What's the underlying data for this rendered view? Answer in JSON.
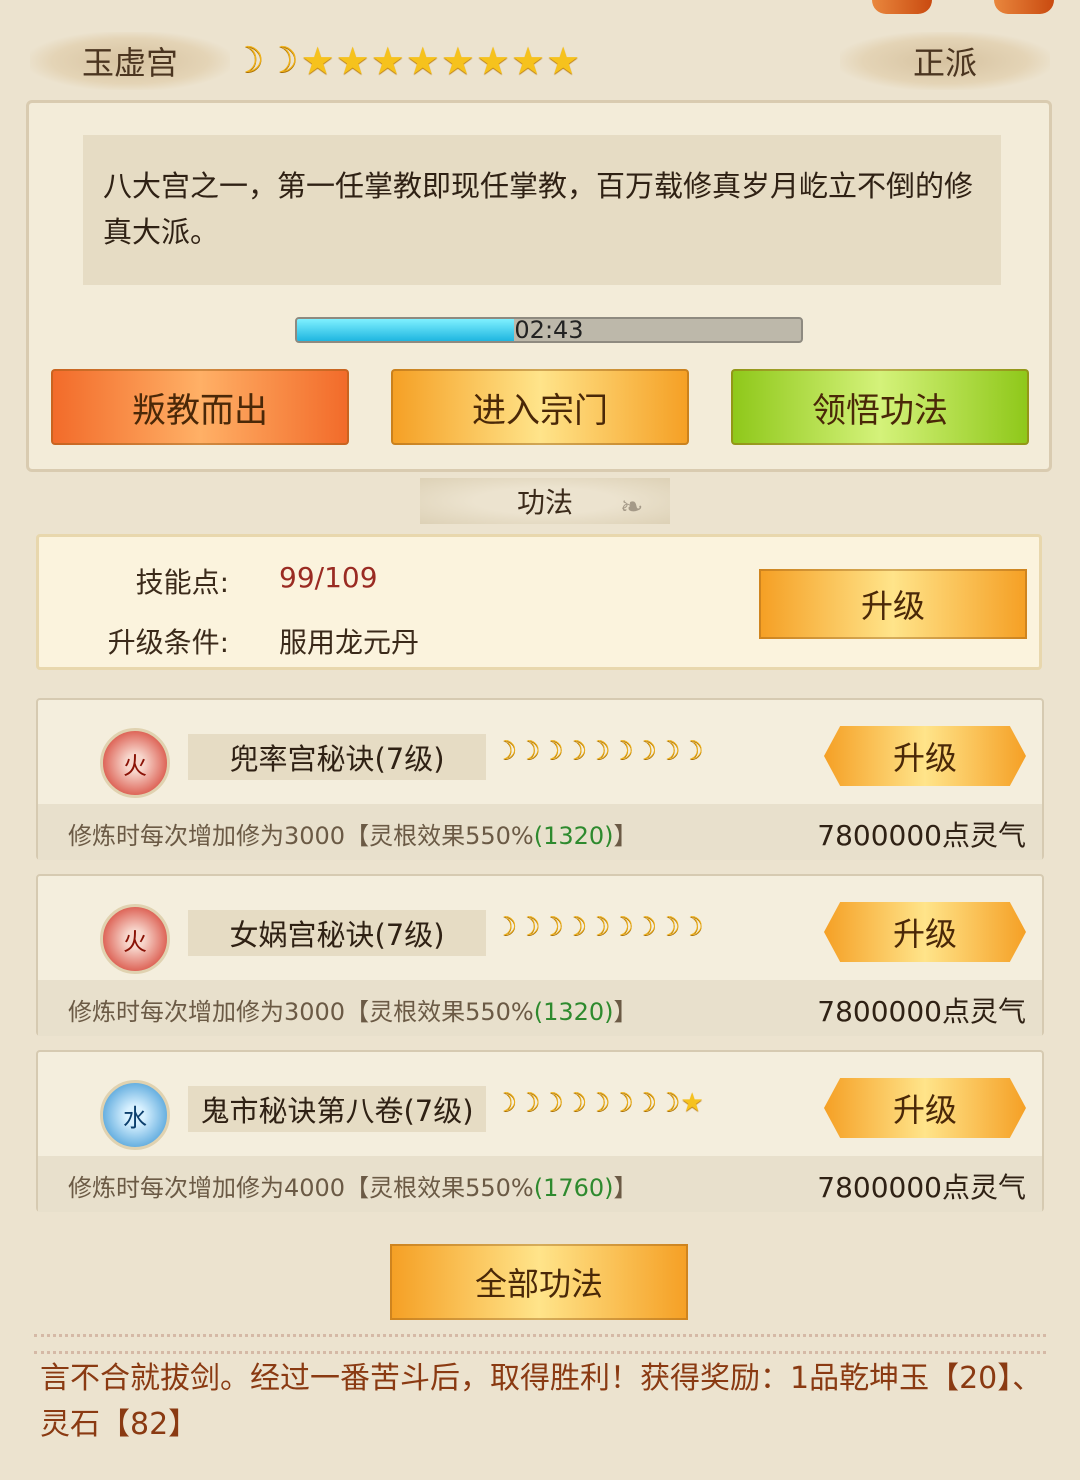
{
  "header": {
    "sect_name": "玉虚宫",
    "faction": "正派",
    "rank": {
      "moons": 2,
      "stars": 8
    }
  },
  "description": "八大宫之一，第一任掌教即现任掌教，百万载修真岁月屹立不倒的修真大派。",
  "timer": {
    "text": "02:43",
    "progress_percent": 43
  },
  "actions": {
    "leave_label": "叛教而出",
    "enter_label": "进入宗门",
    "comprehend_label": "领悟功法"
  },
  "section_title": "功法",
  "skill_points": {
    "label": "技能点:",
    "value": "99/109",
    "condition_label": "升级条件:",
    "condition_value": "服用龙元丹",
    "upgrade_label": "升级"
  },
  "techniques": [
    {
      "element": "火",
      "element_icon": "fire-icon",
      "name": "兜率宫秘诀(7级)",
      "rank": {
        "moons": 9,
        "stars": 0
      },
      "desc_prefix": "修炼时每次增加修为3000【灵根效果550%",
      "desc_bonus": "(1320)",
      "desc_suffix": "】",
      "cost": "7800000点灵气",
      "upgrade_label": "升级"
    },
    {
      "element": "火",
      "element_icon": "fire-icon",
      "name": "女娲宫秘诀(7级)",
      "rank": {
        "moons": 9,
        "stars": 0
      },
      "desc_prefix": "修炼时每次增加修为3000【灵根效果550%",
      "desc_bonus": "(1320)",
      "desc_suffix": "】",
      "cost": "7800000点灵气",
      "upgrade_label": "升级"
    },
    {
      "element": "水",
      "element_icon": "water-icon",
      "name": "鬼市秘诀第八卷(7级)",
      "rank": {
        "moons": 8,
        "stars": 1
      },
      "desc_prefix": "修炼时每次增加修为4000【灵根效果550%",
      "desc_bonus": "(1760)",
      "desc_suffix": "】",
      "cost": "7800000点灵气",
      "upgrade_label": "升级"
    }
  ],
  "all_techniques_label": "全部功法",
  "log_text": "言不合就拔剑。经过一番苦斗后，取得胜利！获得奖励：1品乾坤玉【20】、灵石【82】",
  "colors": {
    "background": "#ece3cf",
    "accent_gold": "#f5a025",
    "leave_red": "#f26b2a",
    "comprehend_green": "#8fc81a",
    "bonus_green": "#2e8a2e",
    "log_brown": "#8a3a12"
  }
}
